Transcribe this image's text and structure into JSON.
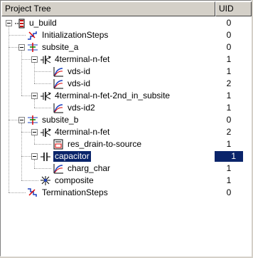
{
  "header": {
    "tree_label": "Project Tree",
    "uid_label": "UID"
  },
  "rows": [
    {
      "label": "u_build",
      "uid": "0",
      "icon": "build-icon",
      "level": 0,
      "expanded": true
    },
    {
      "label": "InitializationSteps",
      "uid": "0",
      "icon": "steps-icon",
      "level": 1
    },
    {
      "label": "subsite_a",
      "uid": "0",
      "icon": "subsite-icon",
      "level": 1,
      "expanded": true
    },
    {
      "label": "4terminal-n-fet",
      "uid": "1",
      "icon": "fet-icon",
      "level": 2,
      "expanded": true
    },
    {
      "label": "vds-id",
      "uid": "1",
      "icon": "curve-icon",
      "level": 3
    },
    {
      "label": "vds-id",
      "uid": "2",
      "icon": "curve-icon",
      "level": 3
    },
    {
      "label": "4terminal-n-fet-2nd_in_subsite",
      "uid": "1",
      "icon": "fet-icon",
      "level": 2,
      "expanded": true
    },
    {
      "label": "vds-id2",
      "uid": "1",
      "icon": "curve-icon",
      "level": 3
    },
    {
      "label": "subsite_b",
      "uid": "0",
      "icon": "subsite-icon",
      "level": 1,
      "expanded": true
    },
    {
      "label": "4terminal-n-fet",
      "uid": "2",
      "icon": "fet-icon",
      "level": 2,
      "expanded": true
    },
    {
      "label": "res_drain-to-source",
      "uid": "1",
      "icon": "document-icon",
      "level": 3
    },
    {
      "label": "capacitor",
      "uid": "1",
      "icon": "capacitor-icon",
      "level": 2,
      "expanded": true,
      "selected": true
    },
    {
      "label": "charg_char",
      "uid": "1",
      "icon": "curve-icon",
      "level": 3
    },
    {
      "label": "composite",
      "uid": "1",
      "icon": "composite-icon",
      "level": 2
    },
    {
      "label": "TerminationSteps",
      "uid": "0",
      "icon": "termination-icon",
      "level": 1
    }
  ],
  "colors": {
    "selection": "#0a246a",
    "panel": "#d4d0c8"
  }
}
